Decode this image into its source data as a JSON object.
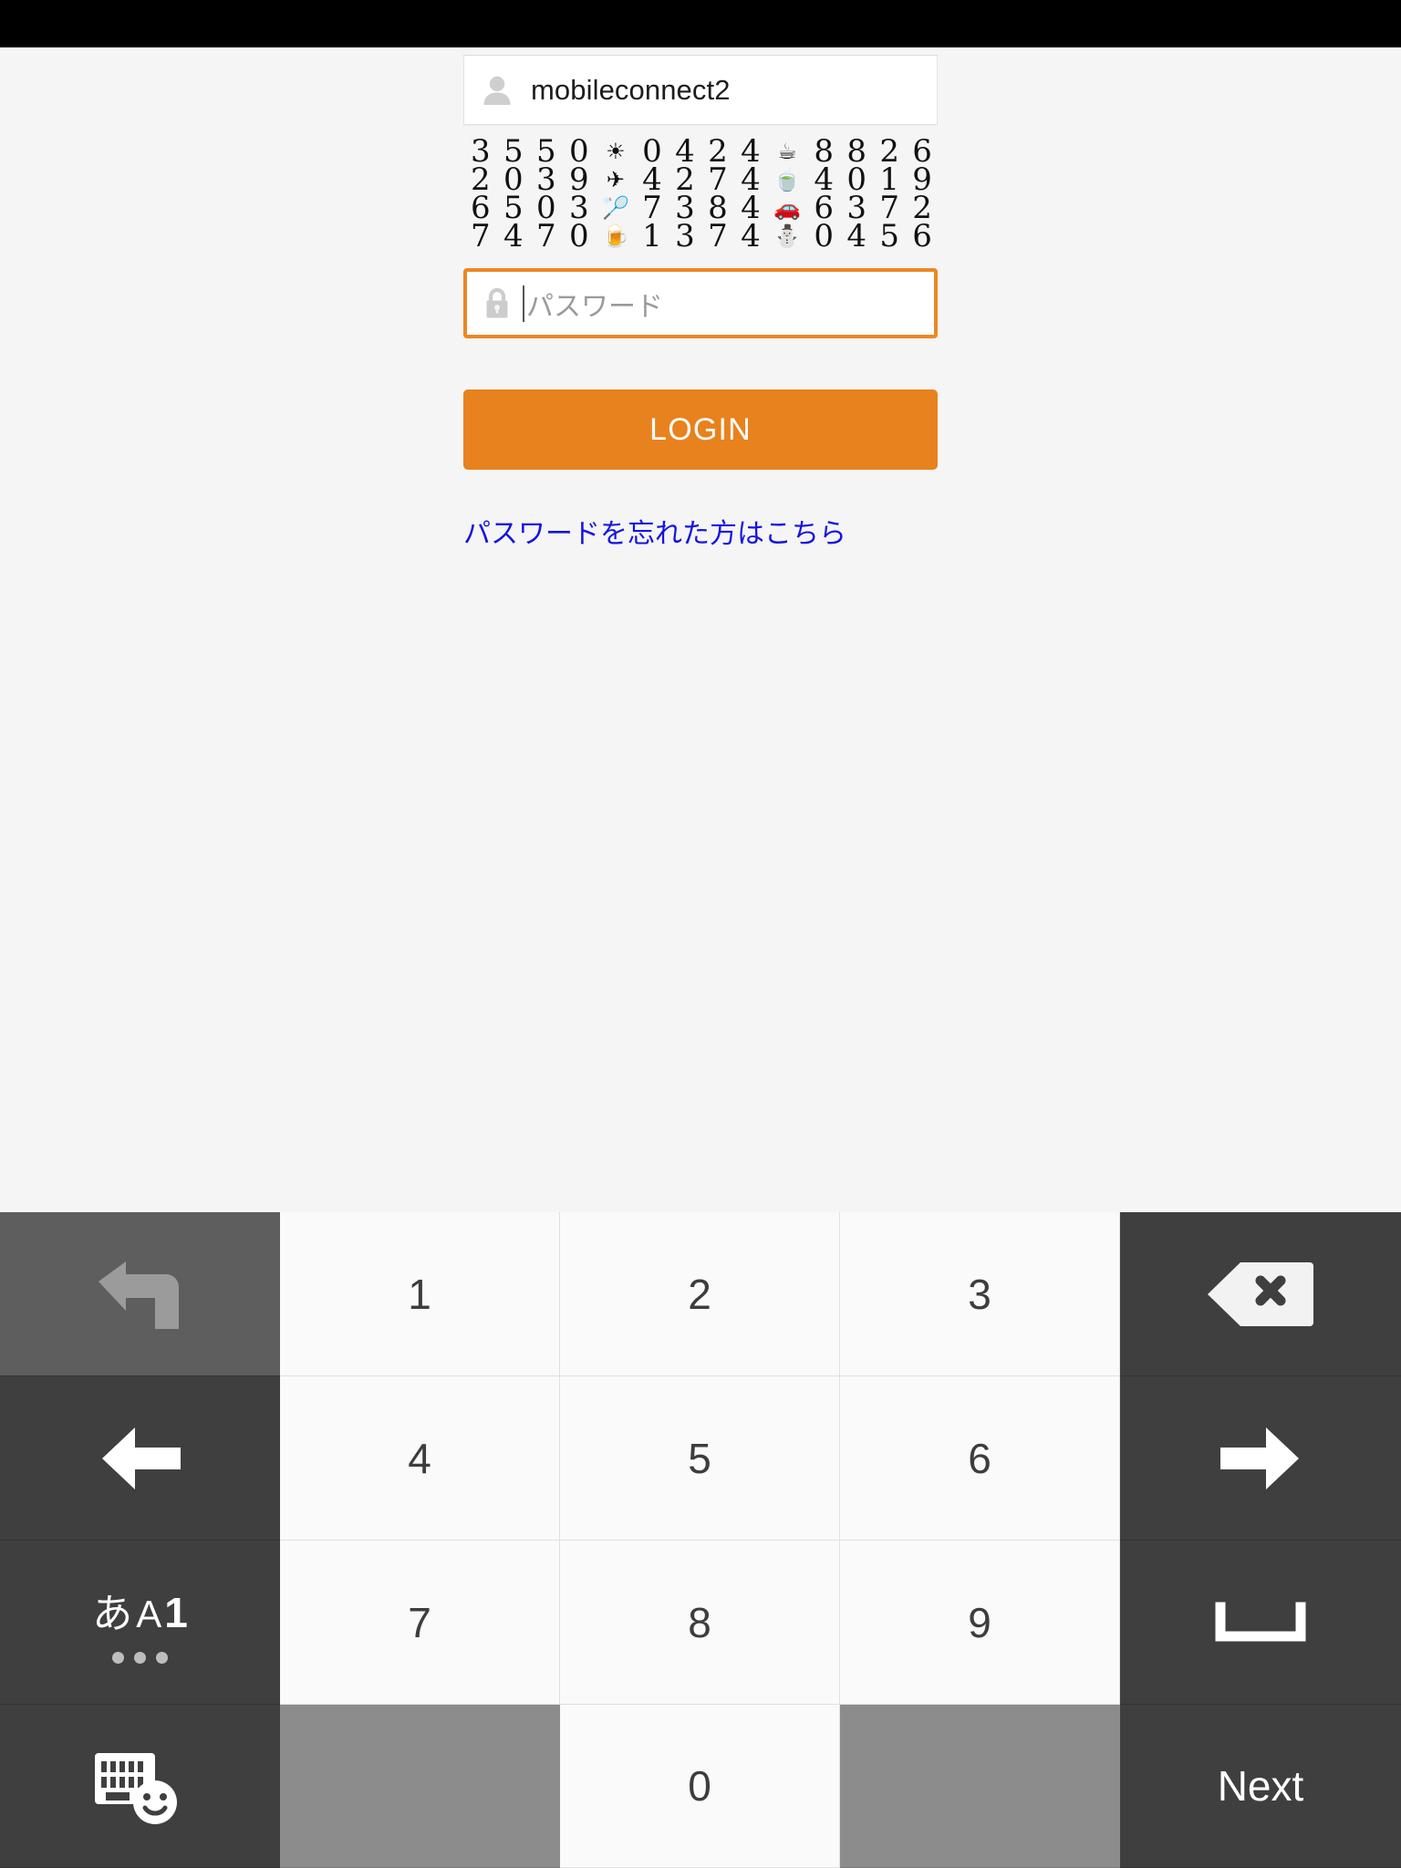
{
  "status_bar": {
    "background": "#000000"
  },
  "theme": {
    "page_bg": "#f5f5f5",
    "accent_orange": "#e8821e",
    "field_focus_border": "#ee8722",
    "link_blue": "#1414e0"
  },
  "login_form": {
    "username": {
      "icon": "person-icon",
      "value": "mobileconnect2"
    },
    "otp_grid": {
      "columns": 13,
      "rows": 4,
      "cells": [
        [
          "3",
          "5",
          "5",
          "0",
          "☀",
          "0",
          "4",
          "2",
          "4",
          "☕",
          "8",
          "8",
          "2",
          "6"
        ],
        [
          "2",
          "0",
          "3",
          "9",
          "✈",
          "4",
          "2",
          "7",
          "4",
          "🍵",
          "4",
          "0",
          "1",
          "9"
        ],
        [
          "6",
          "5",
          "0",
          "3",
          "🏸",
          "7",
          "3",
          "8",
          "4",
          "🚗",
          "6",
          "3",
          "7",
          "2"
        ],
        [
          "7",
          "4",
          "7",
          "0",
          "🍺",
          "1",
          "3",
          "7",
          "4",
          "⛄",
          "0",
          "4",
          "5",
          "6"
        ]
      ],
      "emoji_columns": [
        4,
        9
      ]
    },
    "password": {
      "icon": "lock-icon",
      "placeholder": "パスワード",
      "value": "",
      "focused": true
    },
    "login_label": "LOGIN",
    "forgot_link": "パスワードを忘れた方はこちら"
  },
  "keyboard": {
    "rows": [
      [
        {
          "name": "undo-key",
          "type": "fn-mid",
          "icon": "undo-arrow-icon",
          "label": ""
        },
        {
          "name": "key-1",
          "type": "num",
          "icon": "",
          "label": "1"
        },
        {
          "name": "key-2",
          "type": "num",
          "icon": "",
          "label": "2"
        },
        {
          "name": "key-3",
          "type": "num",
          "icon": "",
          "label": "3"
        },
        {
          "name": "backspace-key",
          "type": "fn-dark",
          "icon": "backspace-icon",
          "label": ""
        }
      ],
      [
        {
          "name": "cursor-left-key",
          "type": "fn-dark",
          "icon": "arrow-left-icon",
          "label": ""
        },
        {
          "name": "key-4",
          "type": "num",
          "icon": "",
          "label": "4"
        },
        {
          "name": "key-5",
          "type": "num",
          "icon": "",
          "label": "5"
        },
        {
          "name": "key-6",
          "type": "num",
          "icon": "",
          "label": "6"
        },
        {
          "name": "cursor-right-key",
          "type": "fn-dark",
          "icon": "arrow-right-icon",
          "label": ""
        }
      ],
      [
        {
          "name": "input-mode-key",
          "type": "fn-dark",
          "icon": "input-mode-icon",
          "label": "あA1"
        },
        {
          "name": "key-7",
          "type": "num",
          "icon": "",
          "label": "7"
        },
        {
          "name": "key-8",
          "type": "num",
          "icon": "",
          "label": "8"
        },
        {
          "name": "key-9",
          "type": "num",
          "icon": "",
          "label": "9"
        },
        {
          "name": "space-key",
          "type": "fn-dark",
          "icon": "space-bar-icon",
          "label": ""
        }
      ],
      [
        {
          "name": "emoji-keyboard-key",
          "type": "fn-dark",
          "icon": "keyboard-emoji-icon",
          "label": ""
        },
        {
          "name": "blank-key-left",
          "type": "blank",
          "icon": "",
          "label": ""
        },
        {
          "name": "key-0",
          "type": "num",
          "icon": "",
          "label": "0"
        },
        {
          "name": "blank-key-right",
          "type": "blank",
          "icon": "",
          "label": ""
        },
        {
          "name": "next-key",
          "type": "fn-dark",
          "icon": "",
          "label": "Next"
        }
      ]
    ],
    "mode_key_chars": {
      "kana": "あ",
      "alpha": "A",
      "num": "1"
    }
  }
}
